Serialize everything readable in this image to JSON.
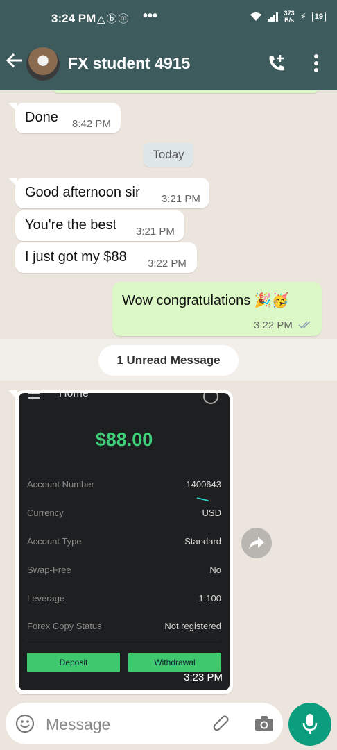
{
  "status_bar": {
    "time": "3:24 PM",
    "notification_icons": "△ⓑⓜ",
    "more": "•••",
    "net_speed_value": "373",
    "net_speed_unit": "B/s",
    "battery": "19"
  },
  "header": {
    "contact_name": "FX student 4915"
  },
  "messages": {
    "m1": {
      "text": "Done",
      "time": "8:42 PM"
    },
    "date_divider": "Today",
    "m2": {
      "text": "Good afternoon sir",
      "time": "3:21 PM"
    },
    "m3": {
      "text": "You're the best",
      "time": "3:21 PM"
    },
    "m4": {
      "text": "I just got my $88",
      "time": "3:22 PM"
    },
    "m5": {
      "text": "Wow congratulations 🎉🥳",
      "time": "3:22 PM"
    },
    "unread_divider": "1 Unread Message",
    "image_msg_time": "3:23 PM"
  },
  "screenshot_content": {
    "title": "Home",
    "balance": "$88.00",
    "rows": [
      {
        "label": "Account Number",
        "value": "1400643"
      },
      {
        "label": "Currency",
        "value": "USD"
      },
      {
        "label": "Account Type",
        "value": "Standard"
      },
      {
        "label": "Swap-Free",
        "value": "No"
      },
      {
        "label": "Leverage",
        "value": "1:100"
      },
      {
        "label": "Forex Copy Status",
        "value": "Not registered"
      }
    ],
    "deposit_label": "Deposit",
    "withdrawal_label": "Withdrawal"
  },
  "input": {
    "placeholder": "Message"
  },
  "icons": {
    "back": "arrow-left-icon",
    "call": "add-call-icon",
    "menu": "more-vertical-icon",
    "share": "forward-icon",
    "emoji": "emoji-icon",
    "attach": "paperclip-icon",
    "camera": "camera-icon",
    "mic": "mic-icon"
  },
  "colors": {
    "header": "#3d5a5c",
    "outgoing_bubble": "#dcf8c6",
    "incoming_bubble": "#ffffff",
    "mic_button": "#0a9e7f",
    "balance_green": "#3fd07a"
  }
}
